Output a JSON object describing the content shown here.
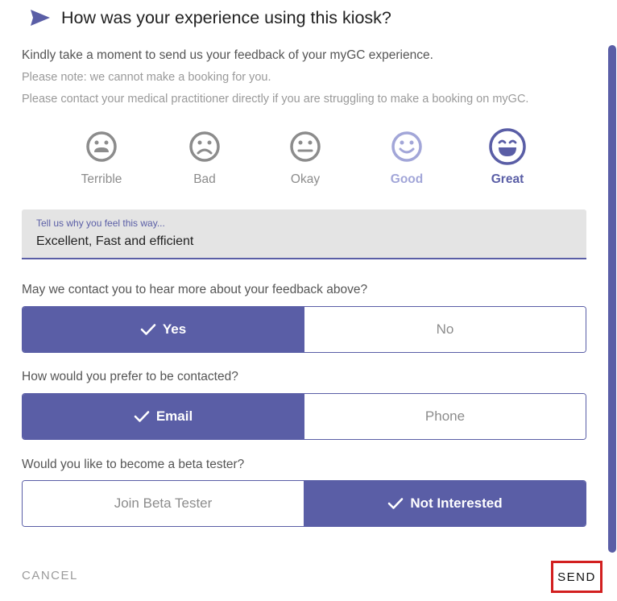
{
  "dialog": {
    "title": "How was your experience using this kiosk?",
    "intro": "Kindly take a moment to send us your feedback of your myGC experience.",
    "note1": "Please note: we cannot make a booking for you.",
    "note2": "Please contact your medical practitioner directly if you are struggling to make a booking on myGC."
  },
  "ratings": [
    {
      "label": "Terrible",
      "icon": "terrible-face-icon"
    },
    {
      "label": "Bad",
      "icon": "bad-face-icon"
    },
    {
      "label": "Okay",
      "icon": "okay-face-icon"
    },
    {
      "label": "Good",
      "icon": "good-face-icon"
    },
    {
      "label": "Great",
      "icon": "great-face-icon",
      "selected": true
    }
  ],
  "feedback": {
    "label": "Tell us why you feel this way...",
    "value": "Excellent, Fast and efficient"
  },
  "contact_question": {
    "question": "May we contact you to hear more about your feedback above?",
    "options": [
      "Yes",
      "No"
    ],
    "selected": "Yes"
  },
  "contact_method": {
    "question": "How would you prefer to be contacted?",
    "options": [
      "Email",
      "Phone"
    ],
    "selected": "Email"
  },
  "beta": {
    "question": "Would you like to become a beta tester?",
    "options": [
      "Join Beta Tester",
      "Not Interested"
    ],
    "selected": "Not Interested"
  },
  "actions": {
    "cancel": "CANCEL",
    "send": "SEND"
  },
  "colors": {
    "accent": "#5a5ea6",
    "accent_light": "#a2a6d8",
    "highlight_border": "#d21f1f"
  }
}
